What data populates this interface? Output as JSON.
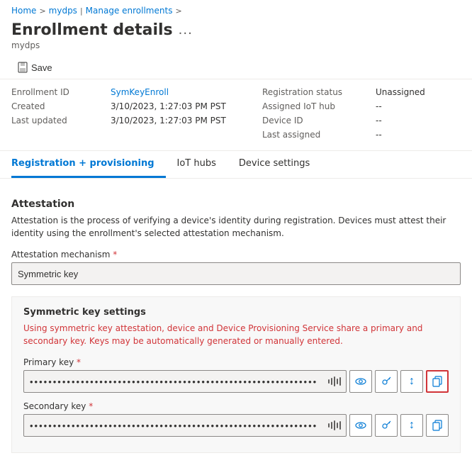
{
  "breadcrumb": {
    "items": [
      "Home",
      "mydps",
      "Manage enrollments"
    ],
    "separators": [
      ">",
      "|",
      ">"
    ]
  },
  "header": {
    "title": "Enrollment details",
    "subtitle": "mydps",
    "ellipsis": "..."
  },
  "toolbar": {
    "save_label": "Save"
  },
  "details": {
    "left": [
      {
        "label": "Enrollment ID",
        "value": "SymKeyEnroll",
        "colored": true
      },
      {
        "label": "Created",
        "value": "3/10/2023, 1:27:03 PM PST",
        "colored": false
      },
      {
        "label": "Last updated",
        "value": "3/10/2023, 1:27:03 PM PST",
        "colored": false
      }
    ],
    "right": [
      {
        "label": "Registration status",
        "value": "Unassigned",
        "colored": false
      },
      {
        "label": "Assigned IoT hub",
        "value": "--",
        "colored": false
      },
      {
        "label": "Device ID",
        "value": "--",
        "colored": false
      },
      {
        "label": "Last assigned",
        "value": "--",
        "colored": false
      }
    ]
  },
  "tabs": [
    {
      "label": "Registration + provisioning",
      "active": true
    },
    {
      "label": "IoT hubs",
      "active": false
    },
    {
      "label": "Device settings",
      "active": false
    }
  ],
  "attestation": {
    "section_title": "Attestation",
    "section_desc": "Attestation is the process of verifying a device's identity during registration. Devices must attest their identity using the enrollment's selected attestation mechanism.",
    "mechanism_label": "Attestation mechanism",
    "mechanism_required": "*",
    "mechanism_value": "Symmetric key",
    "subsection_title": "Symmetric key settings",
    "subsection_desc": "Using symmetric key attestation, device and Device Provisioning Service share a primary and secondary key. Keys may be automatically generated or manually entered.",
    "primary_key_label": "Primary key",
    "primary_key_required": "*",
    "primary_key_placeholder": "••••••••••••••••••••••••••••••••••••••••••••••••••••••••••••••••••••••••••••••••••••••••••••••••••",
    "secondary_key_label": "Secondary key",
    "secondary_key_required": "*",
    "secondary_key_placeholder": "••••••••••••••••••••••••••••••••••••••••••••••••••••••••••••••••••••••••••••••••••••••••••••••••••"
  },
  "icons": {
    "save": "💾",
    "eye": "👁",
    "key": "⚷",
    "arrows_updown": "↕",
    "copy": "⧉"
  }
}
